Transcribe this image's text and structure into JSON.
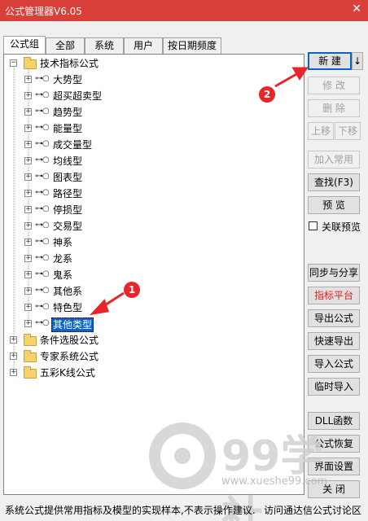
{
  "window": {
    "title": "公式管理器V6.05",
    "close_glyph": "✕"
  },
  "tabs": [
    "公式组",
    "全部",
    "系统",
    "用户",
    "按日期频度"
  ],
  "tree": {
    "root": "技术指标公式",
    "children": [
      "大势型",
      "超买超卖型",
      "趋势型",
      "能量型",
      "成交量型",
      "均线型",
      "图表型",
      "路径型",
      "停损型",
      "交易型",
      "神系",
      "龙系",
      "鬼系",
      "其他系",
      "特色型",
      "其他类型"
    ],
    "groups": [
      "条件选股公式",
      "专家系统公式",
      "五彩K线公式"
    ]
  },
  "buttons": {
    "new": "新 建",
    "new_arrow": "↓",
    "modify": "修 改",
    "delete": "删 除",
    "move_up": "上移",
    "move_down": "下移",
    "add_common": "加入常用",
    "find": "查找(F3)",
    "preview": "预 览",
    "linked_preview": "关联预览",
    "sync_share": "同步与分享",
    "indicator_platform": "指标平台",
    "export": "导出公式",
    "quick_export": "快速导出",
    "import": "导入公式",
    "temp_import": "临时导入",
    "dll": "DLL函数",
    "restore": "公式恢复",
    "interface": "界面设置",
    "close": "关 闭"
  },
  "status": {
    "left": "系统公式提供常用指标及模型的实现样本,不表示操作建议.",
    "right": "访问通达信公式讨论区"
  },
  "annotations": [
    "1",
    "2"
  ],
  "watermark": {
    "brand": "99学社",
    "url": "www.xueshe99.com"
  },
  "colors": {
    "titlebar": "#d9403a",
    "selection": "#0a64c8",
    "annotation": "#e8262a"
  }
}
